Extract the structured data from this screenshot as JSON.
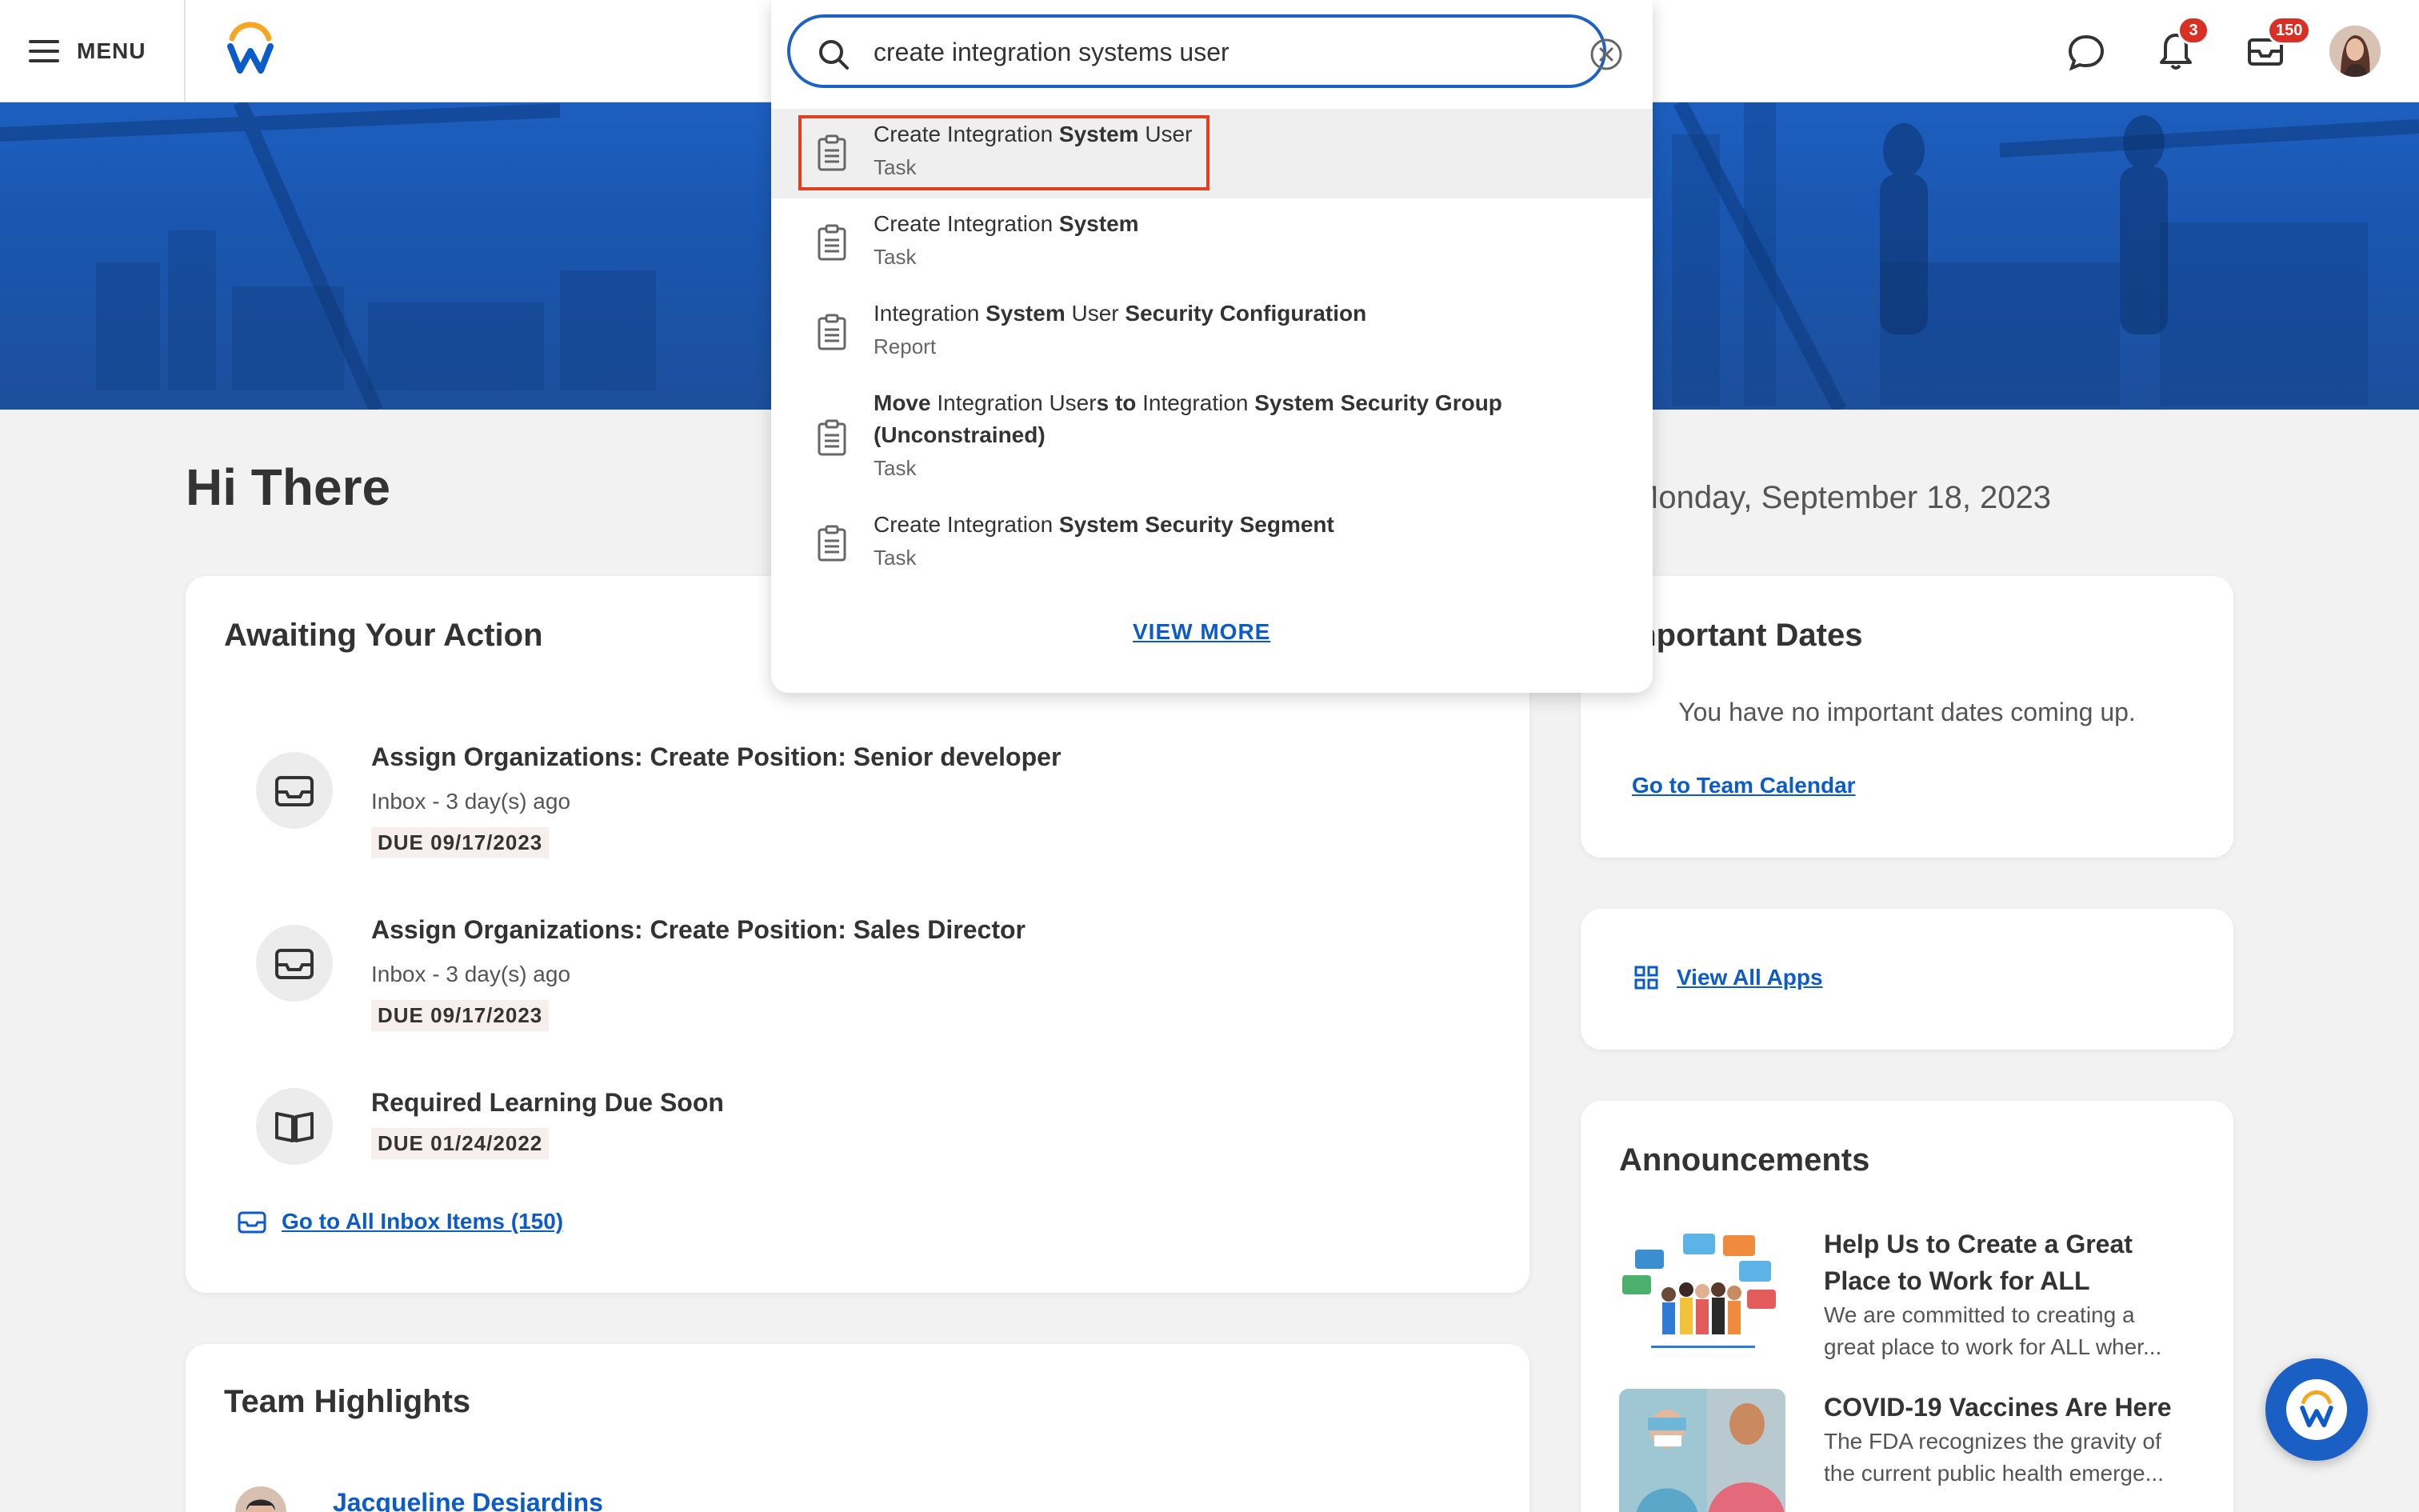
{
  "topbar": {
    "menu_label": "MENU",
    "notifications_count": "3",
    "inbox_count": "150"
  },
  "search": {
    "value": "create integration systems user",
    "results": [
      {
        "title_html": "Create Integration <b>System</b> User",
        "type": "Task"
      },
      {
        "title_html": "Create Integration <b>System</b>",
        "type": "Task"
      },
      {
        "title_html": "Integration <b>System</b> User <b>Security Configuration</b>",
        "type": "Report"
      },
      {
        "title_html": "<b>Move</b> Integration User<b>s</b> <b>to</b> Integration <b>System Security Group</b>",
        "title_line2": "(Unconstrained)",
        "type": "Task"
      },
      {
        "title_html": "Create Integration <b>System Security Segment</b>",
        "type": "Task"
      }
    ],
    "view_more": "VIEW MORE"
  },
  "greeting": "Hi There",
  "date": "Monday, September 18, 2023",
  "awaiting": {
    "title": "Awaiting Your Action",
    "items": [
      {
        "title": "Assign Organizations: Create Position: Senior developer",
        "sub": "Inbox - 3 day(s) ago",
        "due": "DUE 09/17/2023"
      },
      {
        "title": "Assign Organizations: Create Position: Sales Director",
        "sub": "Inbox - 3 day(s) ago",
        "due": "DUE 09/17/2023"
      },
      {
        "title": "Required Learning Due Soon",
        "due": "DUE 01/24/2022"
      }
    ],
    "link": "Go to All Inbox Items (150)"
  },
  "important_dates": {
    "title": "Important Dates",
    "empty": "You have no important dates coming up.",
    "link": "Go to Team Calendar"
  },
  "apps": {
    "link": "View All Apps"
  },
  "announcements": {
    "title": "Announcements",
    "items": [
      {
        "title": "Help Us to Create a Great Place to Work for ALL",
        "body": "We are committed to creating a great place to work for ALL wher..."
      },
      {
        "title": "COVID-19 Vaccines Are Here",
        "body": "The FDA recognizes the gravity of the current public health emerge..."
      }
    ]
  },
  "team": {
    "title": "Team Highlights",
    "person": "Jacqueline Desjardins"
  },
  "colors": {
    "accent": "#1d61c7",
    "link": "#0b5cc8",
    "badge": "#d93025",
    "highlight": "#e0401e"
  }
}
